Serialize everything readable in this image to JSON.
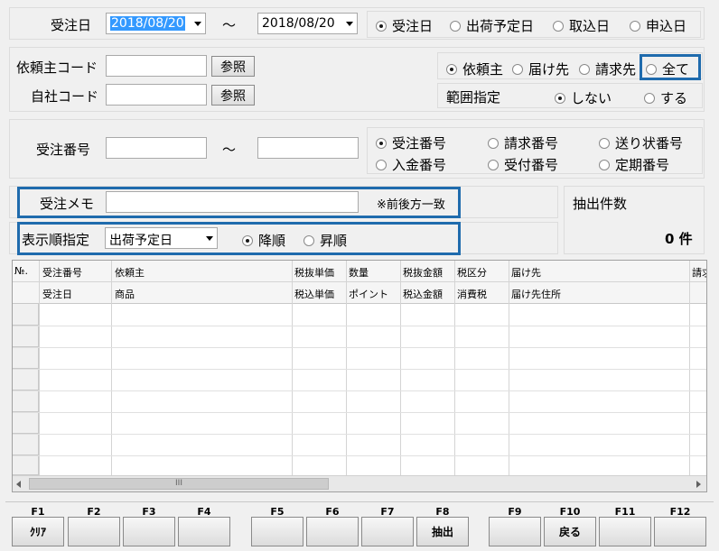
{
  "order_date": {
    "label": "受注日",
    "from": "2018/08/20",
    "tilde": "〜",
    "to": "2018/08/20",
    "options": [
      "受注日",
      "出荷予定日",
      "取込日",
      "申込日"
    ],
    "selected": 0
  },
  "client": {
    "client_code_label": "依頼主コード",
    "own_code_label": "自社コード",
    "ref_label": "参照",
    "target_options": [
      "依頼主",
      "届け先",
      "請求先",
      "全て"
    ],
    "target_selected": 0,
    "range_label": "範囲指定",
    "range_options": [
      "しない",
      "する"
    ],
    "range_selected": 0
  },
  "number": {
    "label": "受注番号",
    "tilde": "〜",
    "options": [
      "受注番号",
      "請求番号",
      "送り状番号",
      "入金番号",
      "受付番号",
      "定期番号"
    ],
    "selected": 0
  },
  "memo": {
    "label": "受注メモ",
    "note": "※前後方一致"
  },
  "sort": {
    "label": "表示順指定",
    "field": "出荷予定日",
    "options": [
      "降順",
      "昇順"
    ],
    "selected": 0
  },
  "count": {
    "label": "抽出件数",
    "value": "0 件"
  },
  "grid": {
    "row_header": "№.",
    "header_top": [
      "受注番号",
      "依頼主",
      "税抜単価",
      "数量",
      "税抜金額",
      "税区分",
      "届け先",
      "請求"
    ],
    "header_bottom": [
      "受注日",
      "商品",
      "税込単価",
      "ポイント",
      "税込金額",
      "消費税",
      "届け先住所",
      ""
    ],
    "scroll_thumb": "III"
  },
  "fkeys": [
    {
      "key": "F1",
      "label": "ｸﾘｱ"
    },
    {
      "key": "F2",
      "label": ""
    },
    {
      "key": "F3",
      "label": ""
    },
    {
      "key": "F4",
      "label": ""
    },
    {
      "key": "F5",
      "label": ""
    },
    {
      "key": "F6",
      "label": ""
    },
    {
      "key": "F7",
      "label": ""
    },
    {
      "key": "F8",
      "label": "抽出"
    },
    {
      "key": "F9",
      "label": ""
    },
    {
      "key": "F10",
      "label": "戻る"
    },
    {
      "key": "F11",
      "label": ""
    },
    {
      "key": "F12",
      "label": ""
    }
  ]
}
